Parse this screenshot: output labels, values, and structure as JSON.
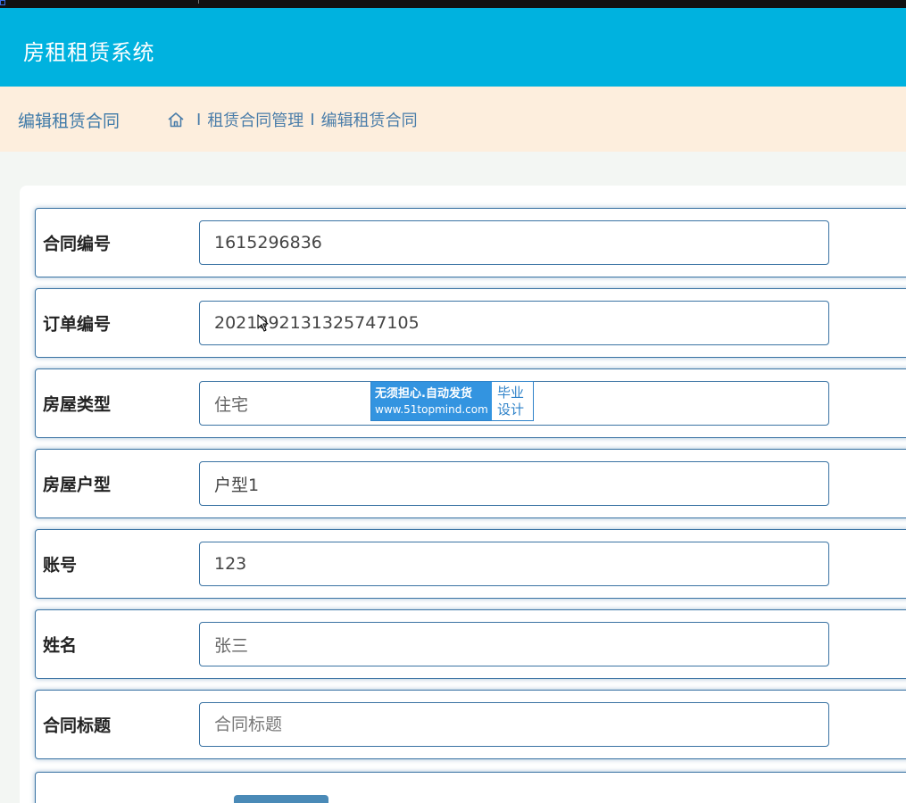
{
  "app": {
    "title": "房租租赁系统"
  },
  "breadcrumb": {
    "page_title": "编辑租赁合同",
    "separator": "I",
    "items": [
      "租赁合同管理",
      "编辑租赁合同"
    ]
  },
  "form": {
    "rows": [
      {
        "label": "合同编号",
        "value": "1615296836",
        "placeholder": ""
      },
      {
        "label": "订单编号",
        "value": "2021092131325747105",
        "placeholder": ""
      },
      {
        "label": "房屋类型",
        "value": "住宅",
        "placeholder": ""
      },
      {
        "label": "房屋户型",
        "value": "户型1",
        "placeholder": ""
      },
      {
        "label": "账号",
        "value": "123",
        "placeholder": ""
      },
      {
        "label": "姓名",
        "value": "张三",
        "placeholder": ""
      },
      {
        "label": "合同标题",
        "value": "",
        "placeholder": "合同标题"
      }
    ]
  },
  "watermark": {
    "line1": "无须担心.自动发货",
    "line2": "www.51topmind.com",
    "right1": "毕业",
    "right2": "设计"
  },
  "colors": {
    "header_bg": "#00b2df",
    "breadcrumb_bg": "#fdeedd",
    "border_blue": "#3a73a3"
  }
}
